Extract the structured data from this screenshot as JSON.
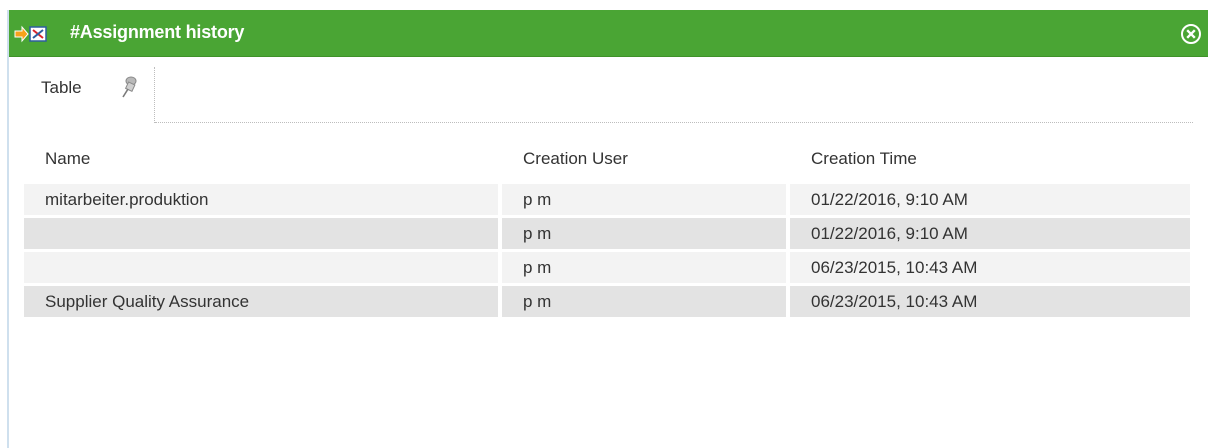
{
  "window": {
    "title": "#Assignment history",
    "title_icon": "assignment-arrow-icon",
    "close_icon": "close-circle-icon",
    "colors": {
      "titlebar": "#4aa534",
      "row_odd": "#f3f3f3",
      "row_even": "#e3e3e3"
    }
  },
  "tabs": [
    {
      "label": "Table",
      "icon": "pin-icon"
    }
  ],
  "table": {
    "columns": [
      "Name",
      "Creation User",
      "Creation Time"
    ],
    "rows": [
      {
        "name": "mitarbeiter.produktion",
        "user": "p m",
        "time": "01/22/2016, 9:10 AM"
      },
      {
        "name": "",
        "user": "p m",
        "time": "01/22/2016, 9:10 AM"
      },
      {
        "name": "",
        "user": "p m",
        "time": "06/23/2015, 10:43 AM"
      },
      {
        "name": "Supplier Quality Assurance",
        "user": "p m",
        "time": "06/23/2015, 10:43 AM"
      }
    ]
  }
}
